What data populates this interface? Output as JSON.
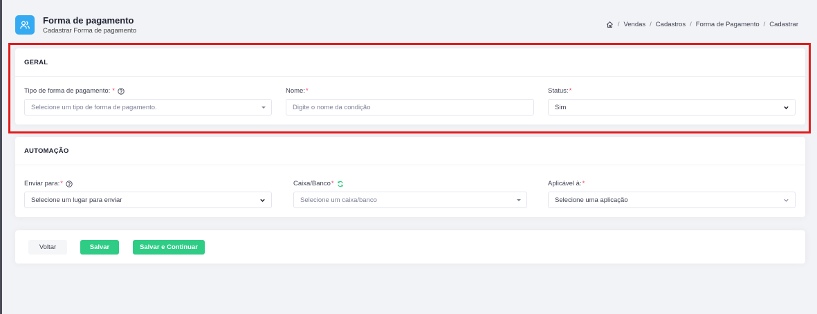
{
  "header": {
    "title": "Forma de pagamento",
    "subtitle": "Cadastrar Forma de pagamento",
    "app_icon": "users-icon",
    "breadcrumb": [
      "Vendas",
      "Cadastros",
      "Forma de Pagamento",
      "Cadastrar"
    ],
    "breadcrumb_home_icon": "home-icon"
  },
  "geral": {
    "section_title": "GERAL",
    "tipo": {
      "label": "Tipo de forma de pagamento:",
      "required": "*",
      "placeholder": "Selecione um tipo de forma de pagamento."
    },
    "nome": {
      "label": "Nome:",
      "required": "*",
      "placeholder": "Digite o nome da condição",
      "value": ""
    },
    "status": {
      "label": "Status:",
      "required": "*",
      "value": "Sim"
    }
  },
  "automacao": {
    "section_title": "AUTOMAÇÃO",
    "enviar": {
      "label": "Enviar para:",
      "required": "*",
      "placeholder": "Selecione um lugar para enviar"
    },
    "caixa": {
      "label": "Caixa/Banco",
      "required": "*",
      "placeholder": "Selecione um caixa/banco"
    },
    "aplicavel": {
      "label": "Aplicável à:",
      "required": "*",
      "placeholder": "Selecione uma aplicação"
    }
  },
  "actions": {
    "voltar": "Voltar",
    "salvar": "Salvar",
    "salvar_continuar": "Salvar e Continuar"
  },
  "colors": {
    "accent_blue": "#34aaf2",
    "success_green": "#2ecc84",
    "required_red": "#f1416c",
    "highlight_red": "#e11a1a"
  }
}
